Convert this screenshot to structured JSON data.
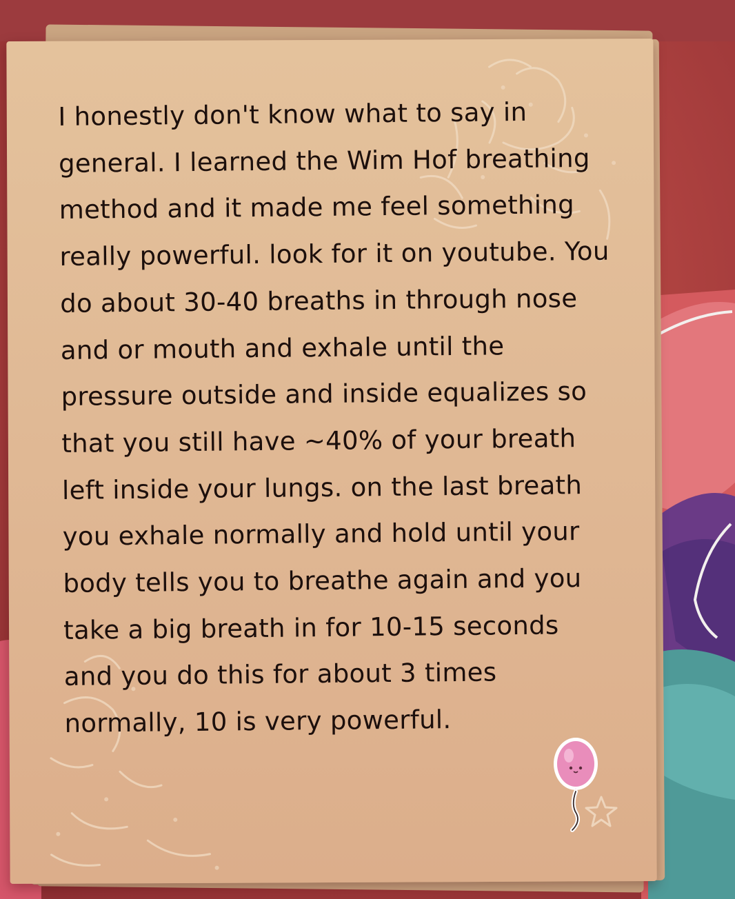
{
  "note": {
    "paragraph": "I honestly don't know what to say in general. I learned the Wim Hof breathing method and it made me feel something really powerful. look for it on youtube. You do about 30-40 breaths in through nose and or mouth and exhale until the pressure outside and inside equalizes so that you still have ~40% of your breath left inside your lungs. on the last breath you exhale normally and hold until your body tells you to breathe again and you take a big breath in for 10-15 seconds and you do this for about 3 times normally, 10 is very powerful."
  },
  "stickers": {
    "balloon": {
      "icon": "balloon-icon",
      "color": "#e98dbb"
    },
    "star": {
      "icon": "star-icon"
    }
  },
  "colors": {
    "background_red": "#b2403d",
    "paper": "#e2bf99",
    "ink": "#1c0f0c",
    "teal_accent": "#4f9a98",
    "purple_accent": "#54307a"
  }
}
